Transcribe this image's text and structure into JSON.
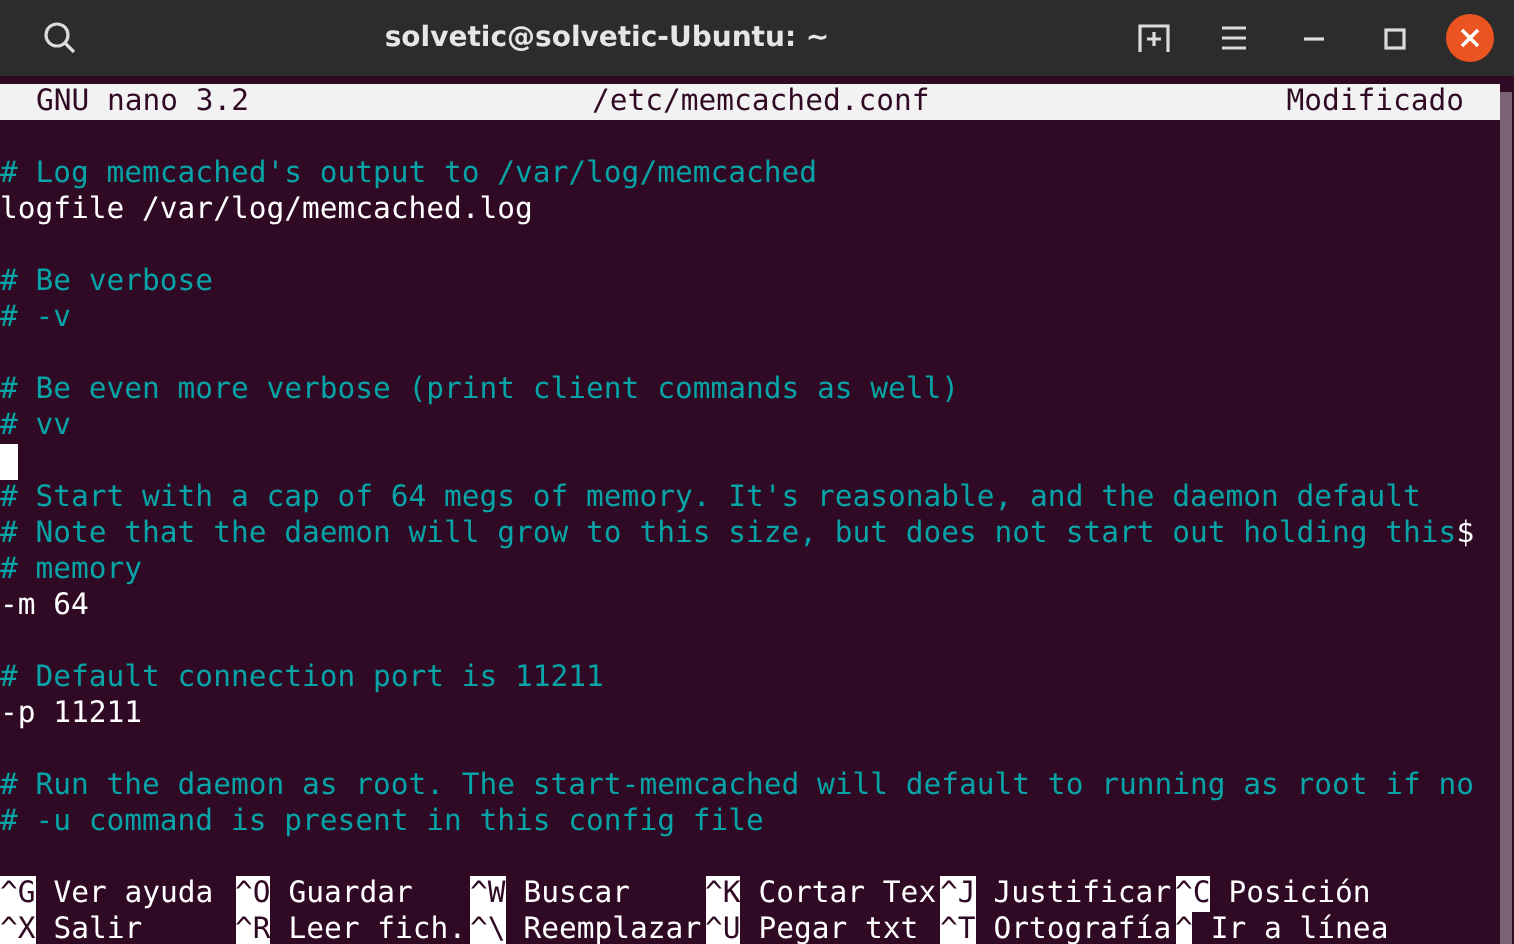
{
  "window": {
    "title": "solvetic@solvetic-Ubuntu: ~"
  },
  "nano_header": {
    "app": "GNU nano 3.2",
    "file": "/etc/memcached.conf",
    "status": "Modificado"
  },
  "lines": [
    {
      "kind": "blank"
    },
    {
      "kind": "comment",
      "text": "# Log memcached's output to /var/log/memcached"
    },
    {
      "kind": "text",
      "text": "logfile /var/log/memcached.log"
    },
    {
      "kind": "blank"
    },
    {
      "kind": "comment",
      "text": "# Be verbose"
    },
    {
      "kind": "comment",
      "text": "# -v"
    },
    {
      "kind": "blank"
    },
    {
      "kind": "comment",
      "text": "# Be even more verbose (print client commands as well)"
    },
    {
      "kind": "comment",
      "text": "# vv"
    },
    {
      "kind": "cursor"
    },
    {
      "kind": "comment",
      "text": "# Start with a cap of 64 megs of memory. It's reasonable, and the daemon default"
    },
    {
      "kind": "comment",
      "text": "# Note that the daemon will grow to this size, but does not start out holding this",
      "overflow_mark": "$"
    },
    {
      "kind": "comment",
      "text": "# memory"
    },
    {
      "kind": "text",
      "text": "-m 64"
    },
    {
      "kind": "blank"
    },
    {
      "kind": "comment",
      "text": "# Default connection port is 11211"
    },
    {
      "kind": "text",
      "text": "-p 11211"
    },
    {
      "kind": "blank"
    },
    {
      "kind": "comment",
      "text": "# Run the daemon as root. The start-memcached will default to running as root if no"
    },
    {
      "kind": "comment",
      "text": "# -u command is present in this config file"
    },
    {
      "kind": "blank"
    }
  ],
  "shortcuts": [
    [
      {
        "key": "^G",
        "label": "Ver ayuda"
      },
      {
        "key": "^O",
        "label": "Guardar"
      },
      {
        "key": "^W",
        "label": "Buscar"
      },
      {
        "key": "^K",
        "label": "Cortar Tex"
      },
      {
        "key": "^J",
        "label": "Justificar"
      },
      {
        "key": "^C",
        "label": "Posición"
      }
    ],
    [
      {
        "key": "^X",
        "label": "Salir"
      },
      {
        "key": "^R",
        "label": "Leer fich."
      },
      {
        "key": "^\\",
        "label": "Reemplazar"
      },
      {
        "key": "^U",
        "label": "Pegar txt"
      },
      {
        "key": "^T",
        "label": "Ortografía"
      },
      {
        "key": "^",
        "label": "Ir a línea"
      }
    ]
  ]
}
